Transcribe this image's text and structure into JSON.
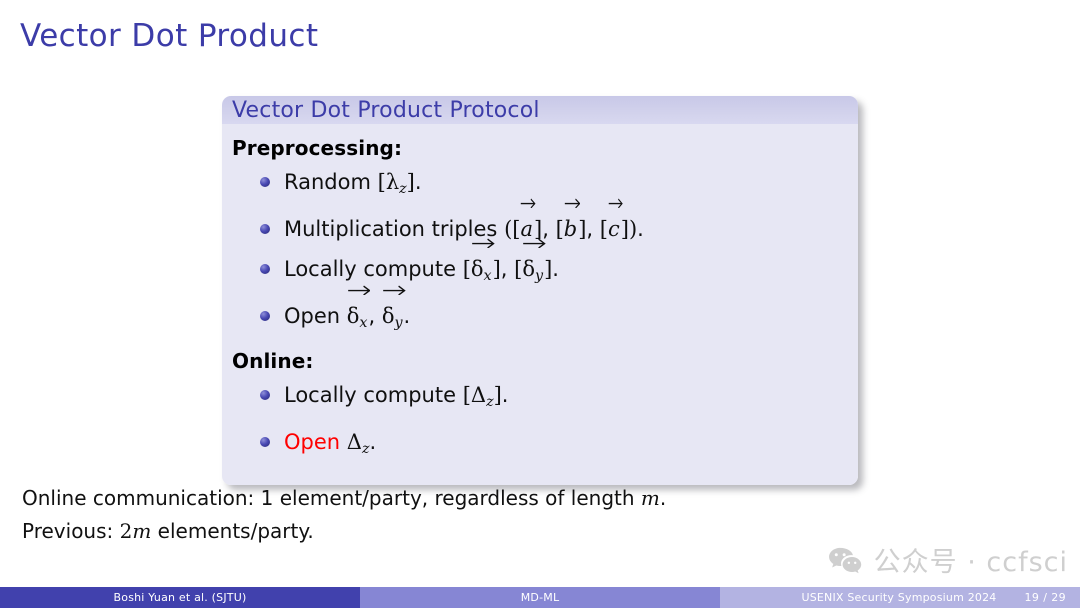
{
  "slide": {
    "title": "Vector Dot Product",
    "page_label": "19 / 29"
  },
  "block": {
    "header_title": "Vector Dot Product Protocol",
    "sections": [
      {
        "label": "Preprocessing:",
        "items": [
          "Random [λz].",
          "Multiplication triples ([a⃗], [b⃗], [c⃗]).",
          "Locally compute [δ⃗x], [δ⃗y].",
          "Open δ⃗x, δ⃗y."
        ]
      },
      {
        "label": "Online:",
        "items": [
          "Locally compute [Δz].",
          "Open Δz."
        ]
      }
    ],
    "highlight_word": "Open",
    "highlight_color": "#ff0000",
    "header_bg": "#d2d2ec",
    "body_bg": "#e7e7f4",
    "title_color": "#3c3ca8"
  },
  "notes": {
    "line1_part1": "Online communication: 1 element/party, regardless of length ",
    "line1_math": "m",
    "line1_end": ".",
    "line2_part1": "Previous: ",
    "line2_math_num": "2",
    "line2_math_var": "m",
    "line2_part2": " elements/party."
  },
  "watermark": {
    "icon": "wechat-bubbles-icon",
    "text": "公众号 · ccfsci",
    "color": "#cfcfcf"
  },
  "footer": {
    "author": "Boshi Yuan et al. (SJTU)",
    "project": "MD-ML",
    "venue": "USENIX Security Symposium 2024",
    "page": "19 / 29",
    "colors": {
      "left": "#4141ad",
      "middle": "#8686d4",
      "right": "#b3b3e2"
    }
  }
}
